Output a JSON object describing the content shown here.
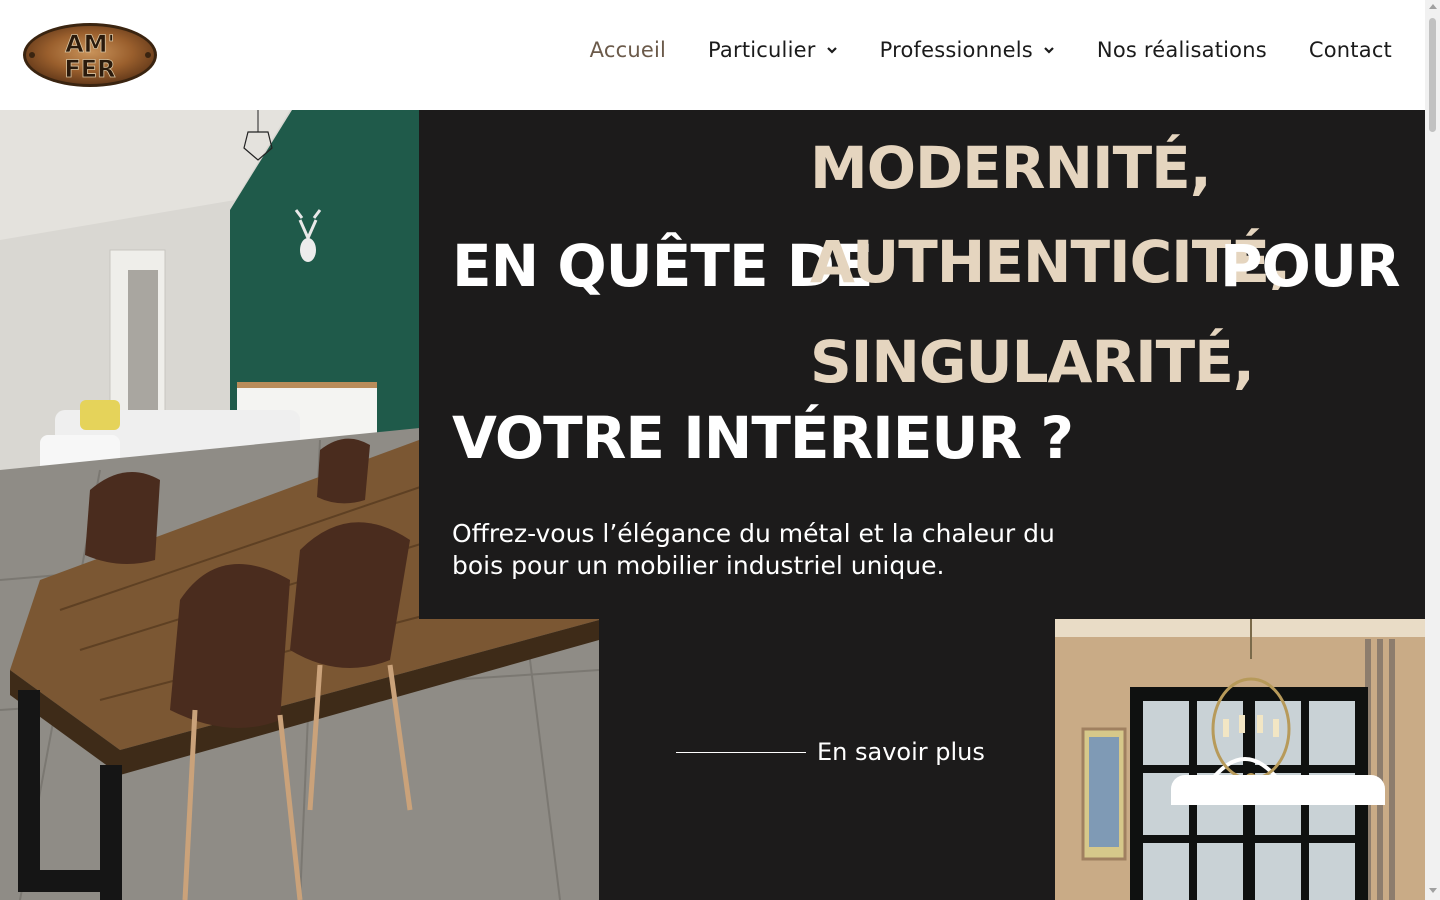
{
  "brand": {
    "logo_text_line1": "AM'",
    "logo_text_line2": "FER"
  },
  "nav": {
    "items": [
      {
        "label": "Accueil",
        "active": true,
        "dropdown": false
      },
      {
        "label": "Particulier",
        "active": false,
        "dropdown": true
      },
      {
        "label": "Professionnels",
        "active": false,
        "dropdown": true
      },
      {
        "label": "Nos réalisations",
        "active": false,
        "dropdown": false
      },
      {
        "label": "Contact",
        "active": false,
        "dropdown": false
      }
    ]
  },
  "hero": {
    "prefix": "EN QUÊTE DE",
    "rotating_words": [
      "MODERNITÉ,",
      "AUTHENTICITÉ,",
      "SINGULARITÉ,"
    ],
    "suffix_a": "POUR",
    "suffix_b": "VOTRE INTÉRIEUR ?",
    "subtitle": "Offrez-vous l’élégance du métal et la chaleur du bois pour un mobilier industriel unique.",
    "cta_label": "En savoir plus"
  },
  "colors": {
    "background_dark": "#1c1b1b",
    "accent_beige": "#e5d5bf",
    "nav_active": "#6b5a4a"
  }
}
